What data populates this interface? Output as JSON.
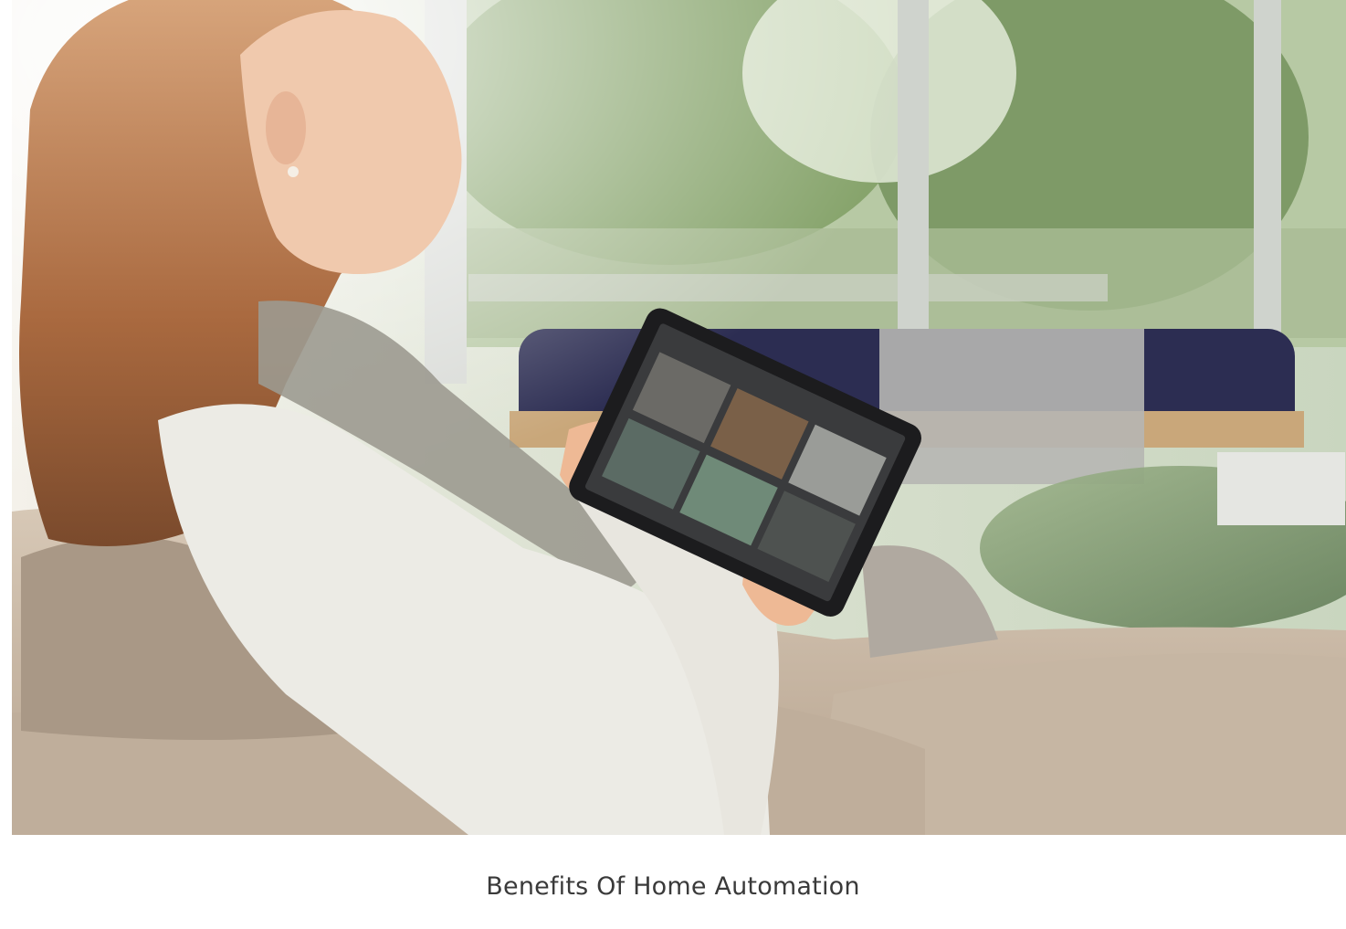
{
  "hero": {
    "subject": "woman-with-tablet-photo"
  },
  "caption": {
    "text": "Benefits Of Home Automation"
  },
  "colors": {
    "background": "#ffffff",
    "caption_text": "#3a3a3a",
    "sofa": "#c9b9a6",
    "ottoman": "#2c2d52",
    "foliage": "#8fae6a"
  }
}
